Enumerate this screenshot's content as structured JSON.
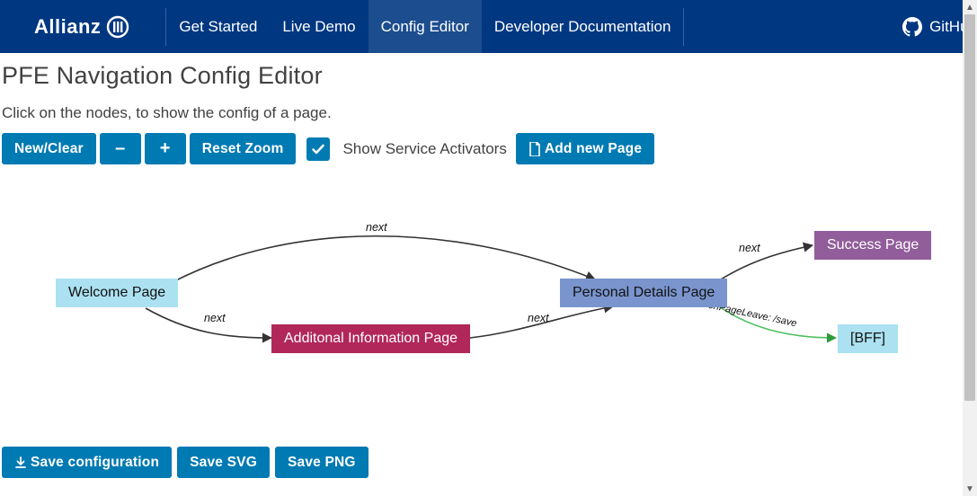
{
  "brand": {
    "name": "Allianz"
  },
  "nav": {
    "items": [
      {
        "label": "Get Started",
        "active": false
      },
      {
        "label": "Live Demo",
        "active": false
      },
      {
        "label": "Config Editor",
        "active": true
      },
      {
        "label": "Developer Documentation",
        "active": false
      }
    ],
    "github_label": "GitHub"
  },
  "page": {
    "title": "PFE Navigation Config Editor",
    "hint": "Click on the nodes, to show the config of a page."
  },
  "toolbar": {
    "new_clear": "New/Clear",
    "zoom_out": "–",
    "zoom_in": "+",
    "reset_zoom": "Reset Zoom",
    "show_sa": "Show Service Activators",
    "add_page": "Add new Page"
  },
  "diagram": {
    "nodes": {
      "welcome": "Welcome Page",
      "additional": "Additonal Information Page",
      "personal": "Personal Details Page",
      "success": "Success Page",
      "bff": "[BFF]"
    },
    "edges": {
      "w_p": "next",
      "w_a": "next",
      "a_p": "next",
      "p_s": "next",
      "p_bff": "onPageLeave: /save"
    }
  },
  "bottom": {
    "save_cfg": "Save configuration",
    "save_svg": "Save SVG",
    "save_png": "Save PNG"
  }
}
